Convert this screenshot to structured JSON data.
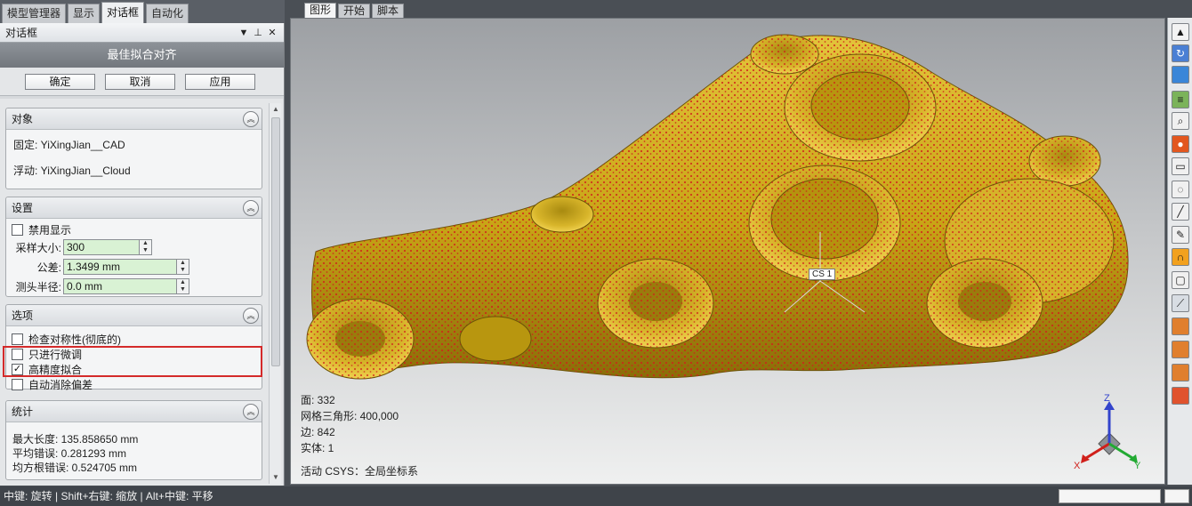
{
  "left_tabs": [
    "模型管理器",
    "显示",
    "对话框",
    "自动化"
  ],
  "dialog": {
    "title": "对话框",
    "title_controls": [
      "▼",
      "⊥",
      "✕"
    ],
    "header": "最佳拟合对齐",
    "buttons": {
      "ok": "确定",
      "cancel": "取消",
      "apply": "应用"
    }
  },
  "objects": {
    "heading": "对象",
    "fixed": "固定: YiXingJian__CAD",
    "floating": "浮动: YiXingJian__Cloud"
  },
  "settings": {
    "heading": "设置",
    "disable_display": {
      "label": "禁用显示",
      "checked": false
    },
    "sample_size": {
      "label": "采样大小:",
      "value": "300"
    },
    "tolerance": {
      "label": "公差:",
      "value": "1.3499 mm"
    },
    "probe_radius": {
      "label": "测头半径:",
      "value": "0.0 mm"
    }
  },
  "options": {
    "heading": "选项",
    "items": [
      {
        "label": "检查对称性(彻底的)",
        "checked": false
      },
      {
        "label": "只进行微调",
        "checked": false
      },
      {
        "label": "高精度拟合",
        "checked": true
      },
      {
        "label": "自动消除偏差",
        "checked": false
      }
    ]
  },
  "stats": {
    "heading": "统计",
    "max_length": "最大长度: 135.858650 mm",
    "avg_error": "平均错误: 0.281293 mm",
    "rms_error": "均方根错误: 0.524705 mm"
  },
  "view_tabs": [
    "图形",
    "开始",
    "脚本"
  ],
  "viewport_info": {
    "faces": "面: 332",
    "mesh": "网格三角形: 400,000",
    "edges": "边: 842",
    "solids": "实体: 1",
    "csys": "活动 CSYS：全局坐标系"
  },
  "cs_label": "CS 1",
  "triad": {
    "x": "X",
    "y": "Y",
    "z": "Z"
  },
  "colors": {
    "model": "#c9a516",
    "points": "#d0201b",
    "highlight": "#d42a2a",
    "x_axis": "#d0201b",
    "y_axis": "#22aa33",
    "z_axis": "#3344cc"
  },
  "right_toolbar_icons": [
    "arrow-icon",
    "rotate-icon",
    "view-icon",
    "layer-icon",
    "zoom-icon",
    "render-icon",
    "select-box-icon",
    "select-lasso-icon",
    "measure-icon",
    "pen-icon",
    "clip-icon",
    "window-icon",
    "mesh-icon",
    "tool-a-icon",
    "tool-b-icon",
    "tool-c-icon",
    "tool-d-icon"
  ],
  "status_bar": "中键: 旋转 | Shift+右键: 缩放 | Alt+中键: 平移"
}
